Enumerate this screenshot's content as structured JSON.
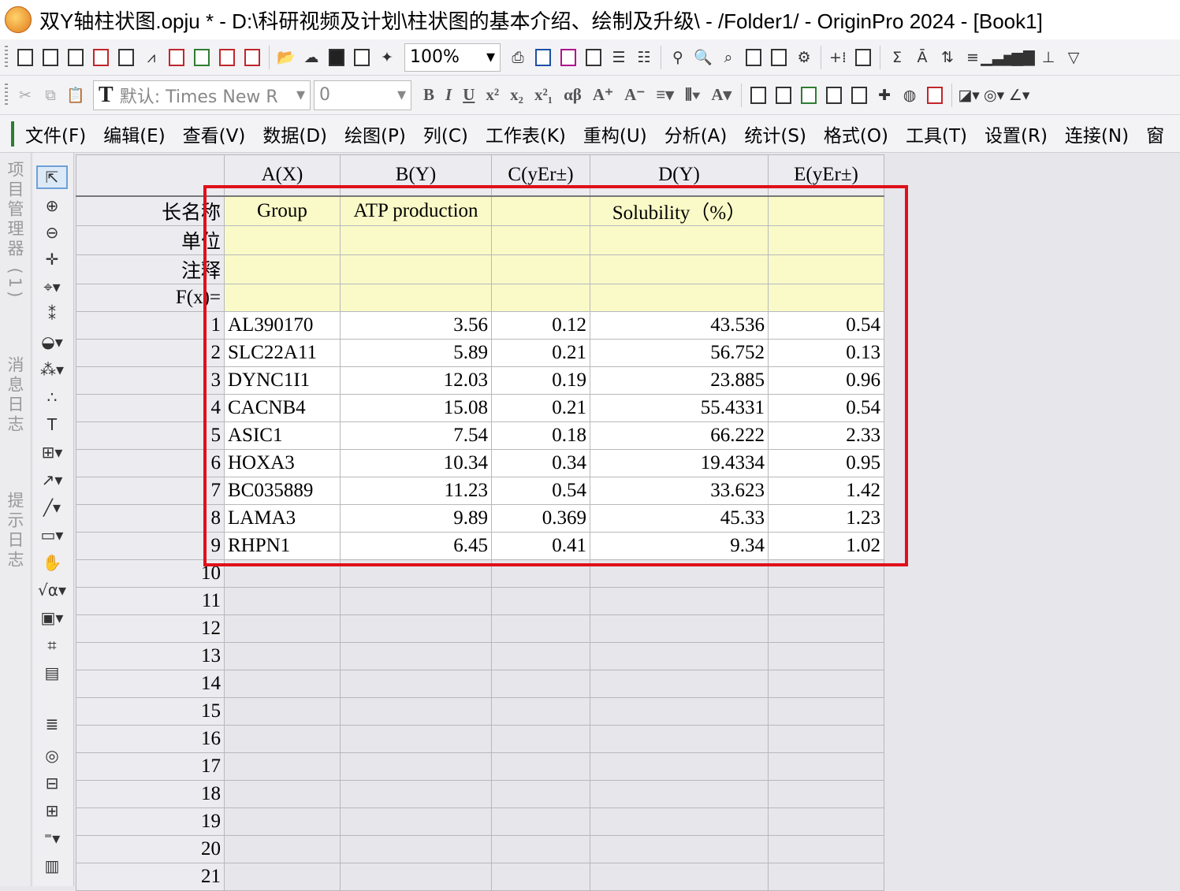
{
  "window": {
    "title": "双Y轴柱状图.opju * - D:\\科研视频及计划\\柱状图的基本介绍、绘制及升级\\ - /Folder1/ - OriginPro 2024 - [Book1]"
  },
  "toolbar": {
    "zoom": "100%",
    "font": "默认: Times New R",
    "font_size": "0"
  },
  "menu": [
    "文件(F)",
    "编辑(E)",
    "查看(V)",
    "数据(D)",
    "绘图(P)",
    "列(C)",
    "工作表(K)",
    "重构(U)",
    "分析(A)",
    "统计(S)",
    "格式(O)",
    "工具(T)",
    "设置(R)",
    "连接(N)",
    "窗"
  ],
  "side_tabs": [
    "项目管理器 (1)",
    "消息日志",
    "提示日志"
  ],
  "worksheet": {
    "columns": [
      "A(X)",
      "B(Y)",
      "C(yEr±)",
      "D(Y)",
      "E(yEr±)"
    ],
    "meta_labels": [
      "长名称",
      "单位",
      "注释",
      "F(x)="
    ],
    "long_names": [
      "Group",
      "ATP production",
      "",
      "Solubility（%）",
      ""
    ],
    "rows": [
      [
        "AL390170",
        "3.56",
        "0.12",
        "43.536",
        "0.54"
      ],
      [
        "SLC22A11",
        "5.89",
        "0.21",
        "56.752",
        "0.13"
      ],
      [
        "DYNC1I1",
        "12.03",
        "0.19",
        "23.885",
        "0.96"
      ],
      [
        "CACNB4",
        "15.08",
        "0.21",
        "55.4331",
        "0.54"
      ],
      [
        "ASIC1",
        "7.54",
        "0.18",
        "66.222",
        "2.33"
      ],
      [
        "HOXA3",
        "10.34",
        "0.34",
        "19.4334",
        "0.95"
      ],
      [
        "BC035889",
        "11.23",
        "0.54",
        "33.623",
        "1.42"
      ],
      [
        "LAMA3",
        "9.89",
        "0.369",
        "45.33",
        "1.23"
      ],
      [
        "RHPN1",
        "6.45",
        "0.41",
        "9.34",
        "1.02"
      ]
    ],
    "empty_row_numbers": [
      "10",
      "11",
      "12",
      "13",
      "14",
      "15",
      "16",
      "17",
      "18",
      "19",
      "20",
      "21"
    ]
  },
  "colors": {
    "highlight_box": "#e0101a",
    "meta_row_bg": "#fafac8"
  }
}
